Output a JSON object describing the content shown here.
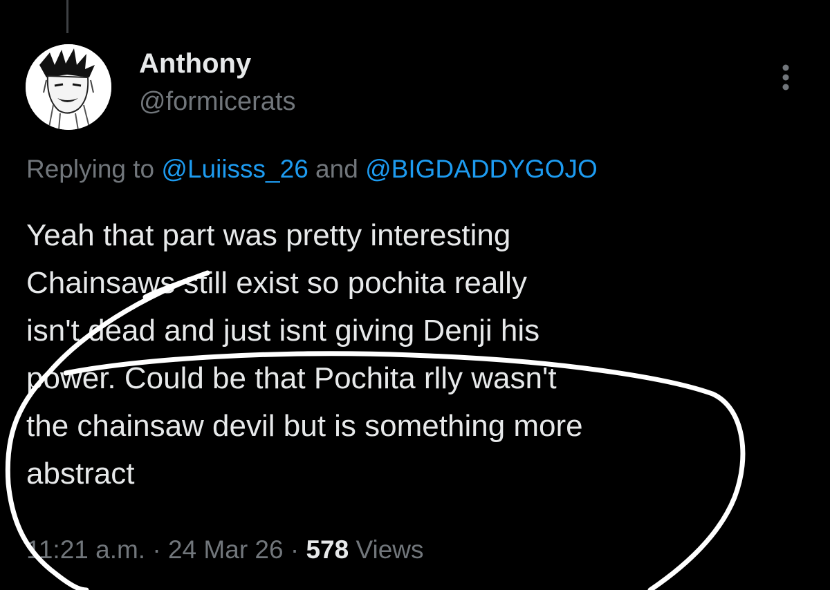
{
  "tweet": {
    "author": {
      "display_name": "Anthony",
      "handle": "@formicerats",
      "avatar_icon": "manga-portrait-avatar"
    },
    "more_icon": "more-vertical-icon",
    "replying": {
      "prefix": "Replying to ",
      "mentions": [
        "@Luiisss_26",
        "@BIGDADDYGOJO"
      ],
      "joiner": " and "
    },
    "text_lines": [
      "Yeah that part was pretty interesting",
      "Chainsaws still exist so pochita really",
      "isn't dead and just isnt giving Denji his",
      "power. Could be that Pochita rlly wasn't",
      "the chainsaw devil but is something more",
      "abstract"
    ],
    "meta": {
      "time": "11:21 a.m.",
      "separator": " · ",
      "date": "24 Mar 26",
      "views_count": "578",
      "views_label": " Views"
    }
  },
  "colors": {
    "background": "#000000",
    "primary_text": "#e7e9ea",
    "secondary_text": "#71767b",
    "link": "#1d9bf0",
    "scribble": "#ffffff"
  }
}
